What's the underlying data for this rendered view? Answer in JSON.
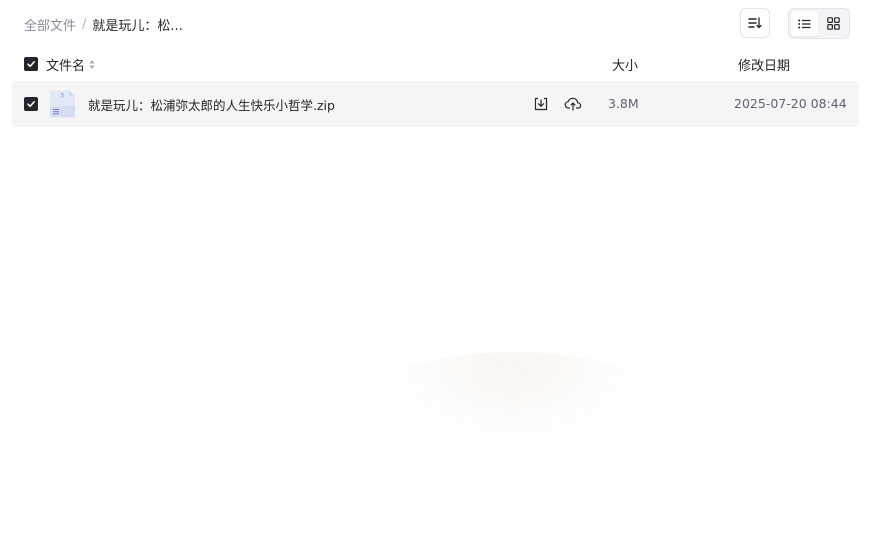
{
  "breadcrumb": {
    "root": "全部文件",
    "separator": "/",
    "current": "就是玩儿：松..."
  },
  "toolbar": {
    "sort_icon": "sort-descending-icon",
    "view_list_icon": "list-view-icon",
    "view_grid_icon": "grid-view-icon",
    "active_view": "list"
  },
  "list_header": {
    "name": "文件名",
    "size": "大小",
    "modified": "修改日期",
    "select_all_checked": true
  },
  "files": [
    {
      "name": "就是玩儿：松浦弥太郎的人生快乐小哲学.zip",
      "icon": "zip-file-icon",
      "size": "3.8M",
      "modified": "2025-07-20 08:44",
      "checked": true,
      "actions": [
        "download-icon",
        "cloud-save-icon"
      ]
    }
  ],
  "colors": {
    "text": "#25262b",
    "muted": "#878c9c",
    "row_selected_bg": "#f5f5f6",
    "checkbox": "#25262b"
  }
}
